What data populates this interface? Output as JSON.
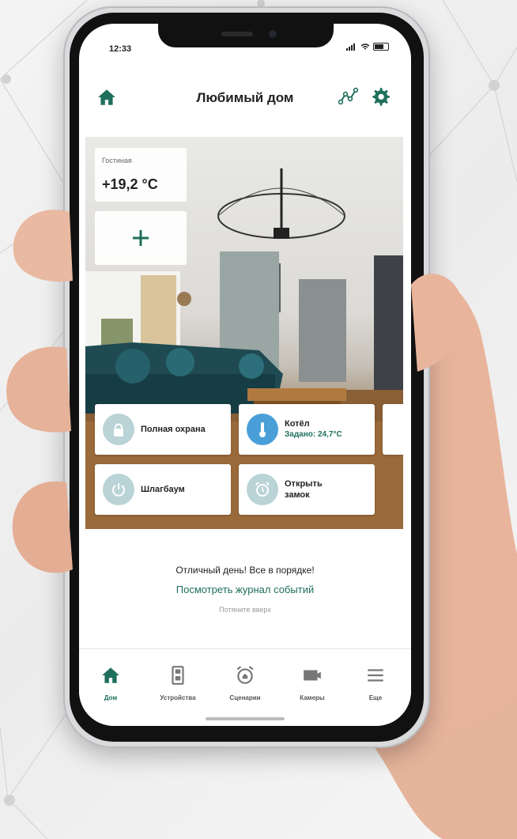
{
  "status_bar": {
    "time": "12:33"
  },
  "header": {
    "title": "Любимый дом"
  },
  "room": {
    "name": "Гостиная",
    "temperature": "+19,2 °C",
    "add_label": "+"
  },
  "tiles": [
    {
      "label": "Полная охрана",
      "sub": ""
    },
    {
      "label": "Котёл",
      "sub": "Задано: 24,7°C"
    },
    {
      "label": "Шлагбаум",
      "sub": ""
    },
    {
      "label": "Открыть замок",
      "sub": ""
    }
  ],
  "messages": {
    "status": "Отличный день! Все в порядке!",
    "log_link": "Посмотреть журнал событий",
    "hint": "Потяните вверх"
  },
  "tabbar": [
    {
      "label": "Дом",
      "icon": "home-icon",
      "active": true
    },
    {
      "label": "Устройства",
      "icon": "devices-icon",
      "active": false
    },
    {
      "label": "Сценарии",
      "icon": "alarm-clock-icon",
      "active": false
    },
    {
      "label": "Камеры",
      "icon": "camera-icon",
      "active": false
    },
    {
      "label": "Еще",
      "icon": "menu-icon",
      "active": false
    }
  ],
  "colors": {
    "accent": "#1e6f5c",
    "tile_icon": "#b9d3d6",
    "boiler_icon": "#4a9fd8"
  }
}
